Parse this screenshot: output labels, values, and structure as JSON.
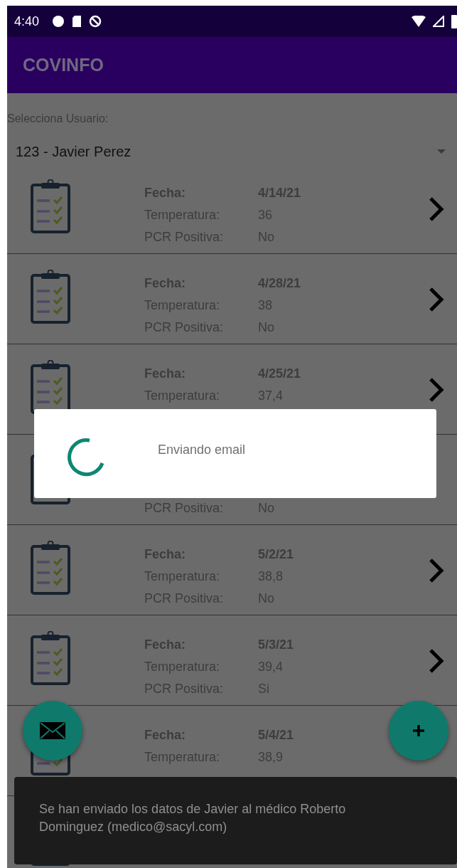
{
  "status_bar": {
    "time": "4:40"
  },
  "app_bar": {
    "title": "COVINFO"
  },
  "user_select": {
    "label": "Selecciona Usuario:",
    "value": "123 - Javier Perez"
  },
  "records": [
    {
      "fields": [
        {
          "kind": "date",
          "label": "Fecha:",
          "value": "4/14/21"
        },
        {
          "kind": "temp",
          "label": "Temperatura:",
          "value": "36"
        },
        {
          "kind": "pcr",
          "label": "PCR Positiva:",
          "value": "No"
        }
      ]
    },
    {
      "fields": [
        {
          "kind": "date",
          "label": "Fecha:",
          "value": "4/28/21"
        },
        {
          "kind": "temp",
          "label": "Temperatura:",
          "value": "38"
        },
        {
          "kind": "pcr",
          "label": "PCR Positiva:",
          "value": "No"
        }
      ]
    },
    {
      "fields": [
        {
          "kind": "date",
          "label": "Fecha:",
          "value": "4/25/21"
        },
        {
          "kind": "temp",
          "label": "Temperatura:",
          "value": "37,4"
        }
      ]
    },
    {
      "chevron": false,
      "fields": [
        {
          "kind": "pcr",
          "label": "PCR Positiva:",
          "value": "No"
        }
      ]
    },
    {
      "fields": [
        {
          "kind": "date",
          "label": "Fecha:",
          "value": "5/2/21"
        },
        {
          "kind": "temp",
          "label": "Temperatura:",
          "value": "38,8"
        },
        {
          "kind": "pcr",
          "label": "PCR Positiva:",
          "value": "No"
        }
      ]
    },
    {
      "fields": [
        {
          "kind": "date",
          "label": "Fecha:",
          "value": "5/3/21"
        },
        {
          "kind": "temp",
          "label": "Temperatura:",
          "value": "39,4"
        },
        {
          "kind": "pcr",
          "label": "PCR Positiva:",
          "value": "Si"
        }
      ]
    },
    {
      "chevron": false,
      "fields": [
        {
          "kind": "date",
          "label": "Fecha:",
          "value": "5/4/21"
        },
        {
          "kind": "temp",
          "label": "Temperatura:",
          "value": "38,9"
        }
      ]
    },
    {
      "chevron": false
    }
  ],
  "progress_dialog": {
    "message": "Enviando email"
  },
  "snackbar": {
    "message": "Se han enviado los datos de Javier al médico Roberto Dominguez (medico@sacyl.com)"
  }
}
